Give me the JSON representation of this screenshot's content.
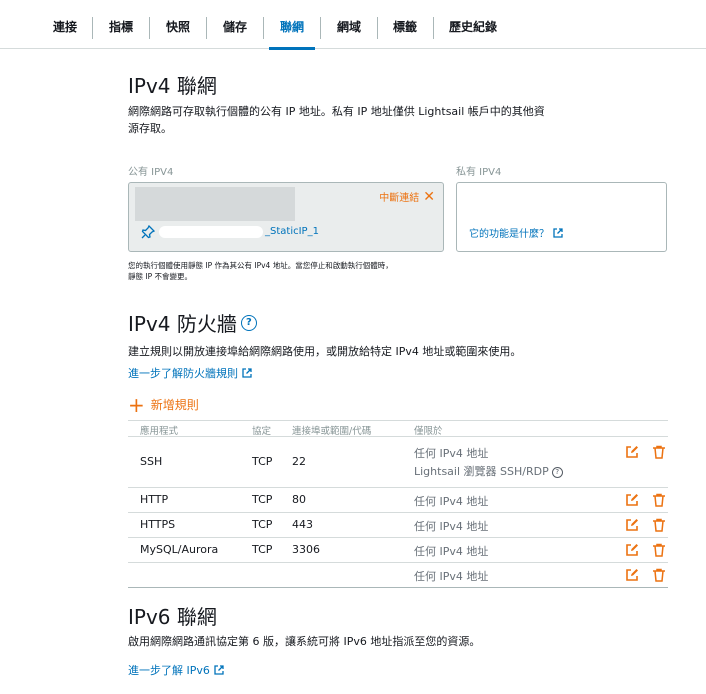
{
  "tabs": [
    {
      "label": "連接",
      "active": false
    },
    {
      "label": "指標",
      "active": false
    },
    {
      "label": "快照",
      "active": false
    },
    {
      "label": "儲存",
      "active": false
    },
    {
      "label": "聯網",
      "active": true
    },
    {
      "label": "網域",
      "active": false
    },
    {
      "label": "標籤",
      "active": false
    },
    {
      "label": "歷史紀錄",
      "active": false
    }
  ],
  "ipv4": {
    "title": "IPv4 聯網",
    "description_line1": "網際網路可存取執行個體的公有 IP 地址。私有 IP 地址僅供 Lightsail 帳戶中的其他資",
    "description_line2": "源存取。",
    "public_label": "公有 IPV4",
    "private_label": "私有 IPV4",
    "detach_label": "中斷連結",
    "static_ip_suffix": "_StaticIP_1",
    "private_link": "它的功能是什麼？",
    "note_line1": "您的執行個體使用靜態 IP 作為其公有 IPv4 地址。當您停止和啟動執行個體時，",
    "note_line2": "靜態 IP 不會變更。"
  },
  "firewall": {
    "title": "IPv4 防火牆",
    "description": "建立規則以開放連接埠給網際網路使用，或開放給特定 IPv4 地址或範圍來使用。",
    "learn_link": "進一步了解防火牆規則",
    "add_rule": "新增規則",
    "headers": {
      "app": "應用程式",
      "protocol": "協定",
      "port": "連接埠或範圍/代碼",
      "restricted": "僅限於"
    },
    "rows": [
      {
        "app": "SSH",
        "protocol": "TCP",
        "port": "22",
        "restricted": "任何 IPv4 地址",
        "restricted2": "Lightsail 瀏覽器 SSH/RDP"
      },
      {
        "app": "HTTP",
        "protocol": "TCP",
        "port": "80",
        "restricted": "任何 IPv4 地址"
      },
      {
        "app": "HTTPS",
        "protocol": "TCP",
        "port": "443",
        "restricted": "任何 IPv4 地址"
      },
      {
        "app": "MySQL/Aurora",
        "protocol": "TCP",
        "port": "3306",
        "restricted": "任何 IPv4 地址"
      },
      {
        "app": "",
        "protocol": "",
        "port": "",
        "restricted": "任何 IPv4 地址"
      }
    ]
  },
  "ipv6": {
    "title": "IPv6 聯網",
    "description": "啟用網際網路通訊協定第 6 版，讓系統可將 IPv6 地址指派至您的資源。",
    "learn_link": "進一步了解 IPv6"
  },
  "colors": {
    "accent": "#0073bb",
    "orange": "#ec7211",
    "border": "#aab7b8"
  }
}
